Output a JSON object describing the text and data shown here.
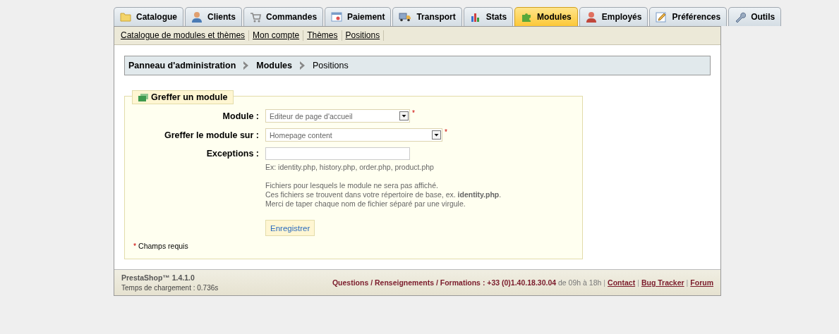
{
  "tabs": [
    {
      "label": "Catalogue",
      "selected": false
    },
    {
      "label": "Clients",
      "selected": false
    },
    {
      "label": "Commandes",
      "selected": false
    },
    {
      "label": "Paiement",
      "selected": false
    },
    {
      "label": "Transport",
      "selected": false
    },
    {
      "label": "Stats",
      "selected": false
    },
    {
      "label": "Modules",
      "selected": true
    },
    {
      "label": "Employés",
      "selected": false
    },
    {
      "label": "Préférences",
      "selected": false
    },
    {
      "label": "Outils",
      "selected": false
    }
  ],
  "subnav": [
    "Catalogue de modules et thèmes",
    "Mon compte",
    "Thèmes",
    "Positions"
  ],
  "breadcrumb": [
    {
      "label": "Panneau d'administration",
      "current": false
    },
    {
      "label": "Modules",
      "current": false
    },
    {
      "label": "Positions",
      "current": true
    }
  ],
  "form": {
    "legend": "Greffer un module",
    "fields": [
      {
        "kind": "select",
        "label": "Module :",
        "value": "Editeur de page d'accueil",
        "required_mark": "*"
      },
      {
        "kind": "select",
        "label": "Greffer le module sur :",
        "value": "Homepage content",
        "required_mark": "*"
      },
      {
        "kind": "text",
        "label": "Exceptions :"
      }
    ],
    "example": "Ex: identity.php, history.php, order.php, product.php",
    "help": [
      "Fichiers pour lesquels le module ne sera pas affiché.",
      "Ces fichiers se trouvent dans votre répertoire de base, ex. **identity.php**.",
      "Merci de taper chaque nom de fichier séparé par une virgule."
    ],
    "submit": "Enregistrer",
    "required_note_mark": "*",
    "required_note": "Champs requis"
  },
  "footer": {
    "version": "PrestaShop™ 1.4.1.0",
    "load_time": "Temps de chargement : 0.736s",
    "contact": "**Questions / Renseignements / Formations : +33 (0)1.40.18.30.04** de 09h à 18h",
    "links": [
      {
        "separator": "|",
        "label": "Contact"
      },
      {
        "separator": "|",
        "label": "Bug Tracker"
      },
      {
        "separator": "|",
        "label": "Forum"
      }
    ]
  }
}
